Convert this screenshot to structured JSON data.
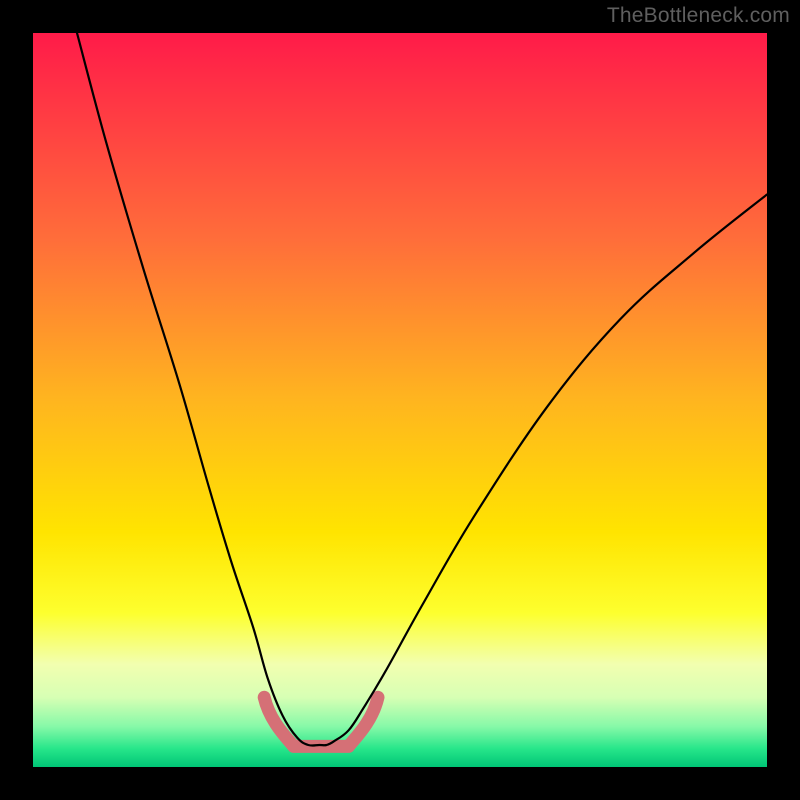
{
  "watermark": {
    "text": "TheBottleneck.com"
  },
  "chart_data": {
    "type": "line",
    "title": "",
    "xlabel": "",
    "ylabel": "",
    "xlim": [
      0,
      100
    ],
    "ylim": [
      0,
      100
    ],
    "grid": false,
    "legend": false,
    "annotations": [],
    "series": [
      {
        "name": "bottleneck-curve",
        "x": [
          6,
          10,
          15,
          20,
          24,
          27,
          30,
          32,
          34,
          36,
          37.5,
          39,
          40,
          41,
          43,
          45,
          48,
          53,
          60,
          70,
          80,
          90,
          100
        ],
        "values": [
          100,
          85,
          68,
          52,
          38,
          28,
          19,
          12,
          7,
          4,
          3,
          3,
          3,
          3.5,
          5,
          8,
          13,
          22,
          34,
          49,
          61,
          70,
          78
        ]
      },
      {
        "name": "sweet-spot-band",
        "x": [
          33,
          44
        ],
        "values": [
          3,
          3
        ]
      }
    ],
    "gradient_stops": [
      {
        "offset": 0.0,
        "color": "#ff1b49"
      },
      {
        "offset": 0.28,
        "color": "#ff6d3a"
      },
      {
        "offset": 0.5,
        "color": "#ffb51f"
      },
      {
        "offset": 0.68,
        "color": "#ffe400"
      },
      {
        "offset": 0.79,
        "color": "#fdff2e"
      },
      {
        "offset": 0.86,
        "color": "#f2ffb0"
      },
      {
        "offset": 0.905,
        "color": "#d7ffb4"
      },
      {
        "offset": 0.945,
        "color": "#86f9a8"
      },
      {
        "offset": 0.975,
        "color": "#27e68a"
      },
      {
        "offset": 1.0,
        "color": "#00c576"
      }
    ],
    "accent_color": "#d57076",
    "curve_color": "#000000"
  }
}
